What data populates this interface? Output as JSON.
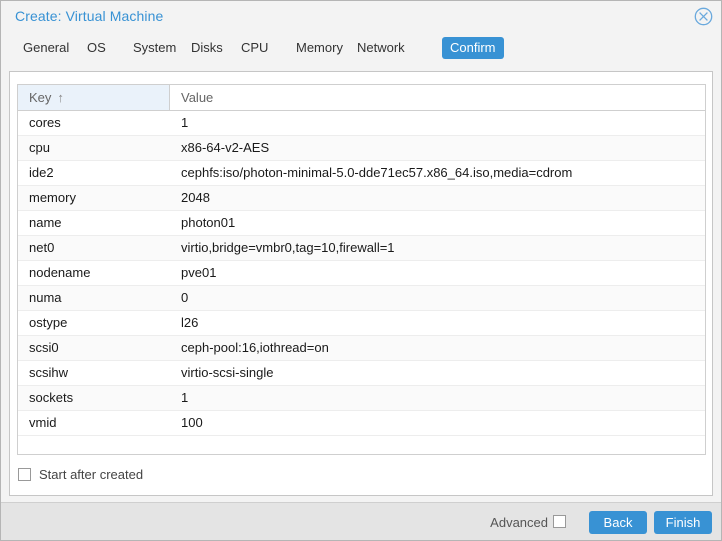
{
  "window": {
    "title": "Create: Virtual Machine",
    "close_icon": "close-circle-icon"
  },
  "tabs": [
    {
      "label": "General",
      "active": false
    },
    {
      "label": "OS",
      "active": false
    },
    {
      "label": "System",
      "active": false
    },
    {
      "label": "Disks",
      "active": false
    },
    {
      "label": "CPU",
      "active": false
    },
    {
      "label": "Memory",
      "active": false
    },
    {
      "label": "Network",
      "active": false
    },
    {
      "label": "Confirm",
      "active": true
    }
  ],
  "grid": {
    "columns": [
      {
        "label": "Key",
        "sorted": true,
        "sort_direction": "asc",
        "sort_glyph": "↑"
      },
      {
        "label": "Value",
        "sorted": false
      }
    ],
    "rows": [
      {
        "key": "cores",
        "value": "1"
      },
      {
        "key": "cpu",
        "value": "x86-64-v2-AES"
      },
      {
        "key": "ide2",
        "value": "cephfs:iso/photon-minimal-5.0-dde71ec57.x86_64.iso,media=cdrom"
      },
      {
        "key": "memory",
        "value": "2048"
      },
      {
        "key": "name",
        "value": "photon01"
      },
      {
        "key": "net0",
        "value": "virtio,bridge=vmbr0,tag=10,firewall=1"
      },
      {
        "key": "nodename",
        "value": "pve01"
      },
      {
        "key": "numa",
        "value": "0"
      },
      {
        "key": "ostype",
        "value": "l26"
      },
      {
        "key": "scsi0",
        "value": "ceph-pool:16,iothread=on"
      },
      {
        "key": "scsihw",
        "value": "virtio-scsi-single"
      },
      {
        "key": "sockets",
        "value": "1"
      },
      {
        "key": "vmid",
        "value": "100"
      }
    ]
  },
  "options": {
    "start_after_created_label": "Start after created",
    "start_after_created_checked": false
  },
  "footer": {
    "advanced_label": "Advanced",
    "advanced_checked": false,
    "back_label": "Back",
    "finish_label": "Finish"
  },
  "colors": {
    "accent": "#3892d4",
    "title_text": "#3892d4",
    "window_bg": "#f3f3f3",
    "footer_bg": "#e4e4e4",
    "sorted_header_bg": "#eaf2fa",
    "row_alt_bg": "#fafafa"
  }
}
